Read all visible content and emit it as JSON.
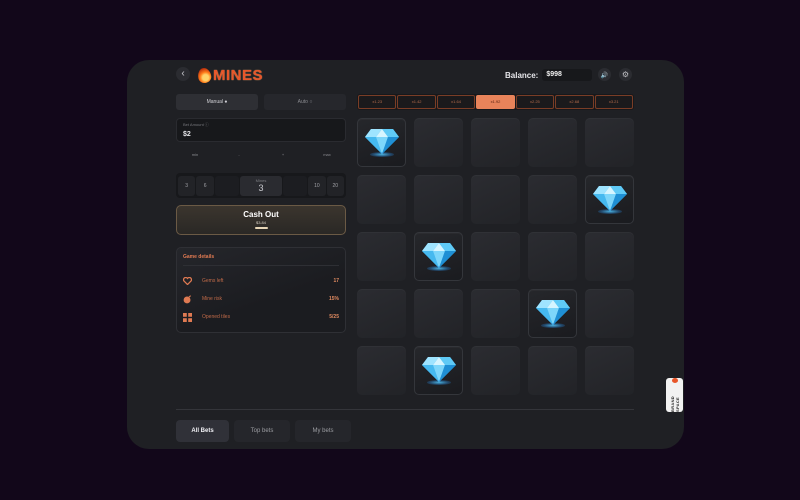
{
  "header": {
    "back_symbol": "‹",
    "logo_text": "MINES",
    "balance_label": "Balance:",
    "balance_value": "$998",
    "sound_symbol": "🔊",
    "settings_symbol": "⚙"
  },
  "mode_tabs": [
    {
      "label": "Manual ●",
      "active": true
    },
    {
      "label": "Auto ○",
      "active": false
    }
  ],
  "bet": {
    "label": "Bet Amount ⓘ",
    "value": "$2"
  },
  "bet_actions": [
    "min",
    "-",
    "+",
    "max"
  ],
  "mines_selector": {
    "left_options": [
      "3",
      "6"
    ],
    "center_label": "Mines",
    "center_value": "3",
    "right_options": [
      "10",
      "20"
    ]
  },
  "cash_out": {
    "label": "Cash Out",
    "amount": "$3.84"
  },
  "game_details": {
    "title": "Game details",
    "rows": [
      {
        "icon": "heart-icon",
        "label": "Gems left",
        "value": "17"
      },
      {
        "icon": "bomb-icon",
        "label": "Mine risk",
        "value": "15%"
      },
      {
        "icon": "tiles-icon",
        "label": "Opened tiles",
        "value": "5/25"
      }
    ]
  },
  "multipliers": [
    {
      "label": "x1.23",
      "active": false
    },
    {
      "label": "x1.42",
      "active": false
    },
    {
      "label": "x1.64",
      "active": false
    },
    {
      "label": "x1.92",
      "active": true
    },
    {
      "label": "x2.25",
      "active": false
    },
    {
      "label": "x2.68",
      "active": false
    },
    {
      "label": "x3.21",
      "active": false
    }
  ],
  "grid": {
    "rows": 5,
    "cols": 5,
    "gems": [
      [
        0,
        0
      ],
      [
        1,
        4
      ],
      [
        2,
        1
      ],
      [
        3,
        3
      ],
      [
        4,
        1
      ]
    ]
  },
  "bottom_tabs": [
    {
      "label": "All Bets",
      "active": true
    },
    {
      "label": "Top bets",
      "active": false
    },
    {
      "label": "My bets",
      "active": false
    }
  ],
  "side_badge": {
    "text": "BRAND SPACE"
  },
  "colors": {
    "accent": "#e8835a",
    "gem": "#4fc3f7",
    "background": "#12071a",
    "panel": "#1f2024"
  }
}
